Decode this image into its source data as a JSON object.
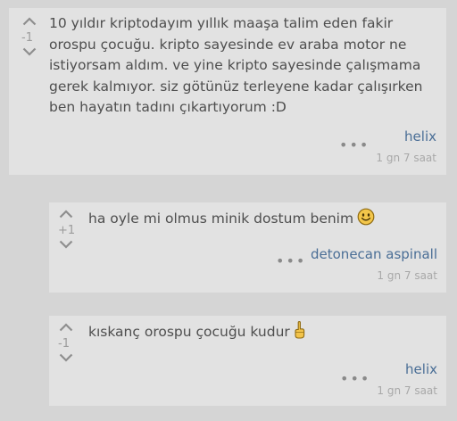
{
  "entries": [
    {
      "score": "-1",
      "text": "10 yıldır kriptodayım yıllık maaşa talim eden fakir orospu çocuğu. kripto sayesinde ev araba motor ne istiyorsam aldım. ve yine kripto sayesinde çalışmama gerek kalmıyor. siz götünüz terleyene kadar çalışırken ben hayatın tadını çıkartıyorum :D",
      "author": "helix",
      "date": "1 gn 7 saat",
      "more": "•••"
    },
    {
      "score": "+1",
      "text": "ha oyle mi olmus minik dostum benim",
      "emoji": "smiley-face-emoji",
      "author": "detonecan aspinall",
      "date": "1 gn 7 saat",
      "more": "•••"
    },
    {
      "score": "-1",
      "text": "kıskanç orospu çocuğu kudur",
      "emoji": "middle-finger-emoji",
      "author": "helix",
      "date": "1 gn 7 saat",
      "more": "•••"
    }
  ],
  "colors": {
    "page_background": "#d5d5d5",
    "card_background": "#e2e2e2",
    "text": "#4e4e4e",
    "author_link": "#4a6e96",
    "muted": "#a8a8a8"
  }
}
